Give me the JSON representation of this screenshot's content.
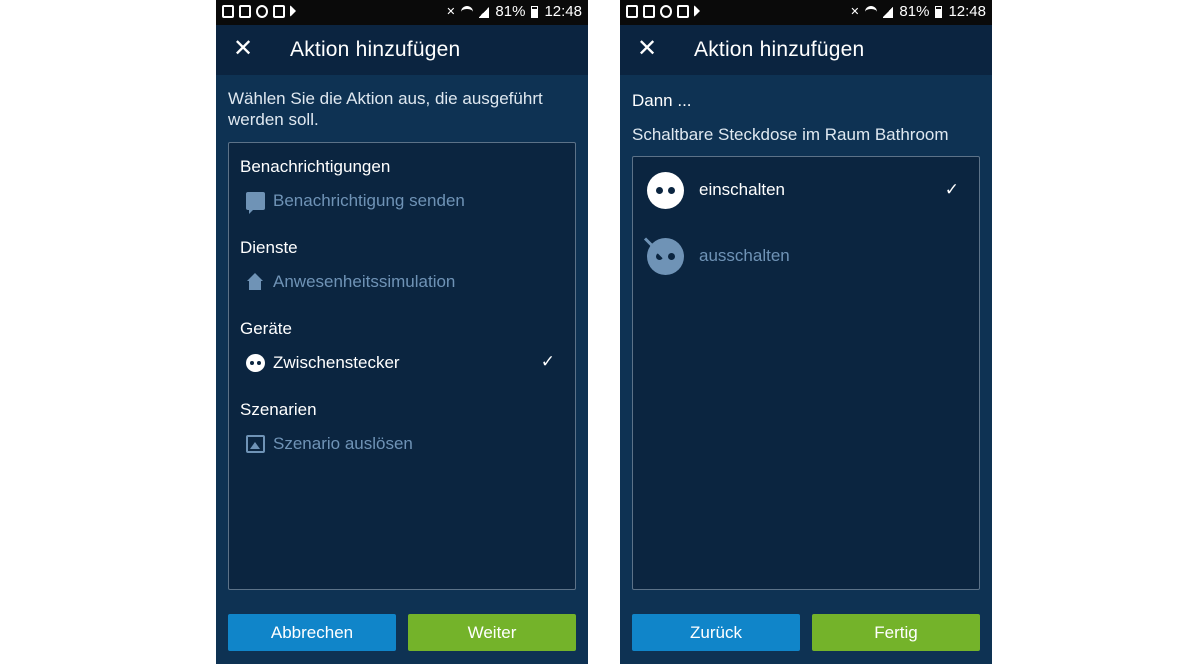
{
  "status_bar": {
    "battery": "81%",
    "time": "12:48"
  },
  "left_screen": {
    "title": "Aktion hinzufügen",
    "intro": "Wählen Sie die Aktion aus, die ausgeführt werden soll.",
    "sections": [
      {
        "title": "Benachrichtigungen",
        "item": "Benachrichtigung senden",
        "icon": "chat-icon",
        "selected": false
      },
      {
        "title": "Dienste",
        "item": "Anwesenheitssimulation",
        "icon": "house-person-icon",
        "selected": false
      },
      {
        "title": "Geräte",
        "item": "Zwischenstecker",
        "icon": "plug-icon",
        "selected": true
      },
      {
        "title": "Szenarien",
        "item": "Szenario auslösen",
        "icon": "scene-icon",
        "selected": false
      }
    ],
    "cancel_label": "Abbrechen",
    "next_label": "Weiter"
  },
  "right_screen": {
    "title": "Aktion hinzufügen",
    "heading": "Dann ...",
    "subheading": "Schaltbare Steckdose im Raum Bathroom",
    "options": [
      {
        "label": "einschalten",
        "icon": "plug-icon",
        "selected": true
      },
      {
        "label": "ausschalten",
        "icon": "plug-off-icon",
        "selected": false
      }
    ],
    "back_label": "Zurück",
    "done_label": "Fertig"
  },
  "colors": {
    "background": "#0e3253",
    "appbar": "#0b2440",
    "card": "#0b2540",
    "dim_text": "#6f93b6",
    "blue_button": "#1085c9",
    "green_button": "#74b32a"
  }
}
